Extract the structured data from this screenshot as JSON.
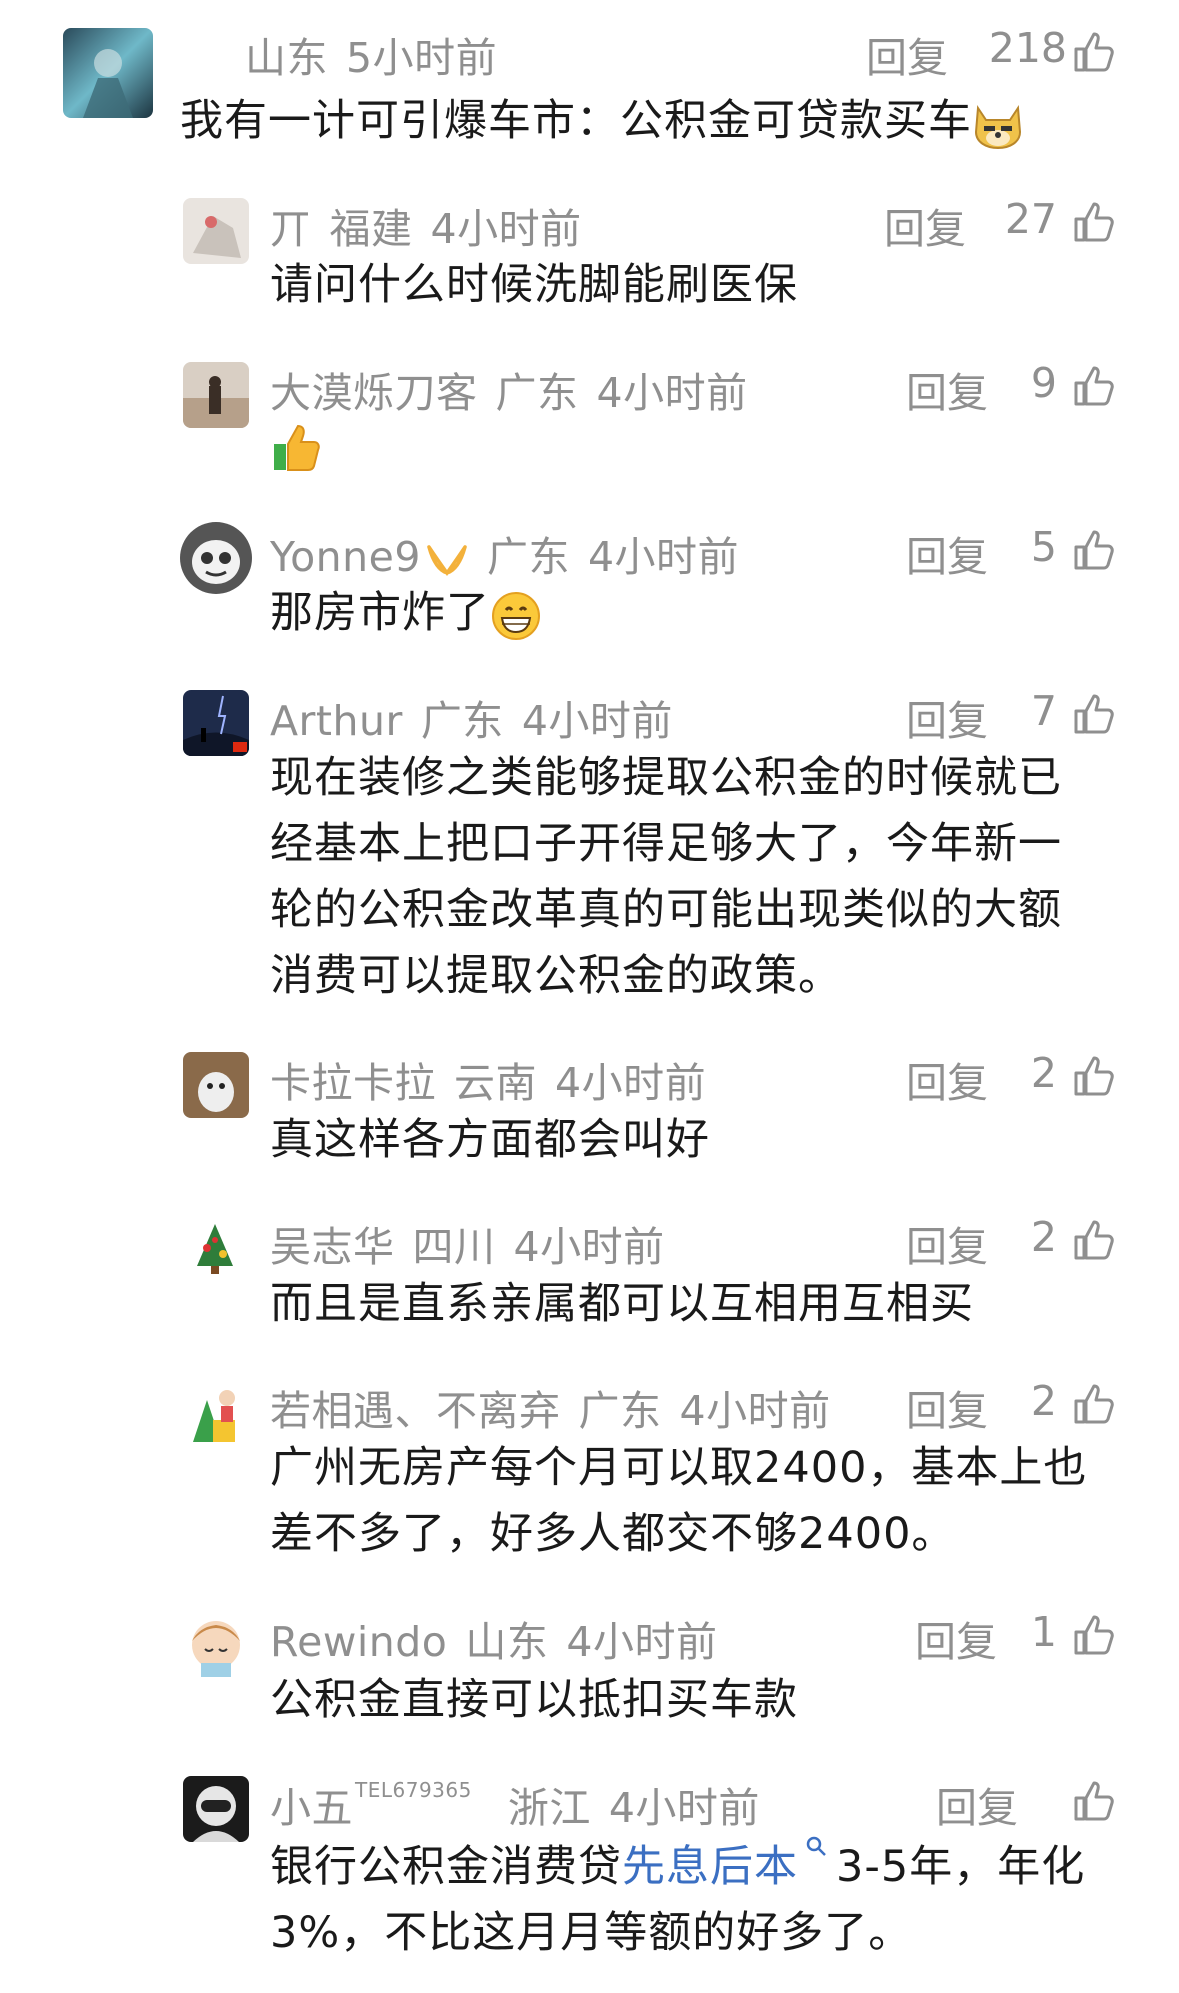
{
  "comments": [
    {
      "name": "",
      "region": "山东",
      "time": "5小时前",
      "reply": "回复",
      "likes": "218",
      "lines": [
        "我有一计可引爆车市：公积金可贷款买车"
      ]
    },
    {
      "name": "丌",
      "region": "福建",
      "time": "4小时前",
      "reply": "回复",
      "likes": "27",
      "lines": [
        "请问什么时候洗脚能刷医保"
      ]
    },
    {
      "name": "大漠烁刀客",
      "region": "广东",
      "time": "4小时前",
      "reply": "回复",
      "likes": "9",
      "lines": []
    },
    {
      "name": "Yonne9",
      "region": "广东",
      "time": "4小时前",
      "reply": "回复",
      "likes": "5",
      "lines": [
        "那房市炸了"
      ]
    },
    {
      "name": "Arthur",
      "region": "广东",
      "time": "4小时前",
      "reply": "回复",
      "likes": "7",
      "lines": [
        "现在装修之类能够提取公积金的时候就已",
        "经基本上把口子开得足够大了，今年新一",
        "轮的公积金改革真的可能出现类似的大额",
        "消费可以提取公积金的政策。"
      ]
    },
    {
      "name": "卡拉卡拉",
      "region": "云南",
      "time": "4小时前",
      "reply": "回复",
      "likes": "2",
      "lines": [
        "真这样各方面都会叫好"
      ]
    },
    {
      "name": "吴志华",
      "region": "四川",
      "time": "4小时前",
      "reply": "回复",
      "likes": "2",
      "lines": [
        "而且是直系亲属都可以互相用互相买"
      ]
    },
    {
      "name": "若相遇、不离弃",
      "region": "广东",
      "time": "4小时前",
      "reply": "回复",
      "likes": "2",
      "lines": [
        "广州无房产每个月可以取2400，基本上也",
        "差不多了，好多人都交不够2400。"
      ]
    },
    {
      "name": "Rewindo",
      "region": "山东",
      "time": "4小时前",
      "reply": "回复",
      "likes": "1",
      "lines": [
        "公积金直接可以抵扣买车款"
      ]
    },
    {
      "name": "小五",
      "name_sup": "TEL679365",
      "region": "浙江",
      "time": "4小时前",
      "reply": "回复",
      "likes": "",
      "lines_prefix": "银行公积金消费贷",
      "link": "先息后本",
      "lines_suffix": "3-5年，年化",
      "line2": "3%，不比这月月等额的好多了。"
    }
  ]
}
